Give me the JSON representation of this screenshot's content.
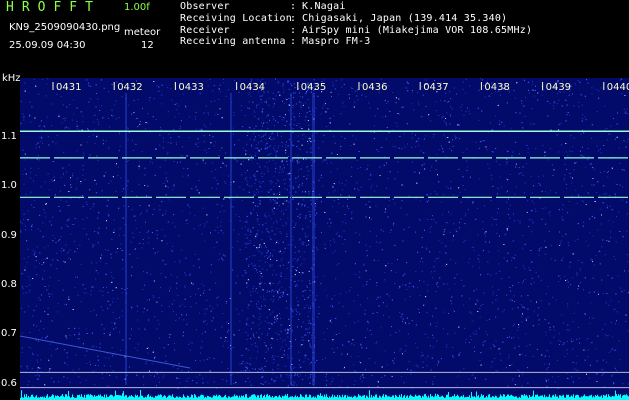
{
  "header": {
    "title": "HROFFT",
    "version": "1.00f",
    "file_name": "KN9_2509090430.png",
    "mode": "meteor",
    "datetime": "25.09.09 04:30",
    "count": "12"
  },
  "station_info": [
    {
      "key": "Observer",
      "value": "K.Nagai"
    },
    {
      "key": "Receiving Location",
      "value": "Chigasaki, Japan (139.414 35.340)"
    },
    {
      "key": "Receiver",
      "value": "AirSpy mini (Miakejima VOR 108.65MHz)"
    },
    {
      "key": "Receiving antenna",
      "value": "Maspro FM-3"
    }
  ],
  "chart_data": {
    "type": "heatmap",
    "x_ticks": [
      "0431",
      "0432",
      "0433",
      "0434",
      "0435",
      "0436",
      "0437",
      "0438",
      "0439",
      "0440"
    ],
    "y_unit": "kHz",
    "y_ticks": [
      "1.1",
      "1.0",
      "0.9",
      "0.8",
      "0.7",
      "0.6"
    ],
    "y_tick_values": [
      1.1,
      1.0,
      0.9,
      0.8,
      0.7,
      0.6
    ],
    "ylim": [
      0.575,
      1.22
    ],
    "carrier_lines_khz": [
      1.112,
      1.058,
      0.978
    ],
    "reference_lines_khz": [
      0.623,
      0.592
    ],
    "colors": {
      "background": "#020a6a",
      "noise": "#3a5cff",
      "carrier": "#9affd8",
      "reference": "#b8b8d8",
      "tick": "#ffffcc",
      "baseline": "#00ffff"
    }
  }
}
